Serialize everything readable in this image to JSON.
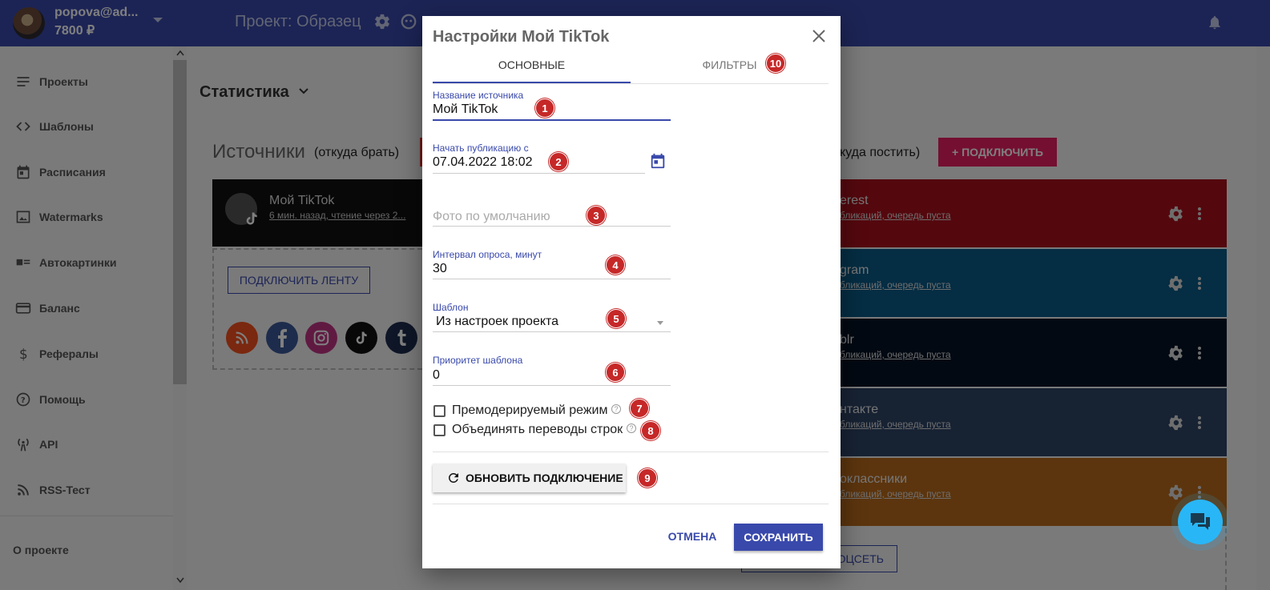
{
  "topbar": {
    "user_email": "popova@ad...",
    "user_balance": "7800 ₽",
    "project_title": "Проект: Образец"
  },
  "sidebar": {
    "items": [
      {
        "label": "Проекты",
        "icon": "list-icon"
      },
      {
        "label": "Шаблоны",
        "icon": "code-icon"
      },
      {
        "label": "Расписания",
        "icon": "calendar-icon"
      },
      {
        "label": "Watermarks",
        "icon": "image-icon"
      },
      {
        "label": "Автокартинки",
        "icon": "picture-list-icon"
      },
      {
        "label": "Баланс",
        "icon": "credit-card-icon"
      },
      {
        "label": "Рефералы",
        "icon": "dollar-icon"
      },
      {
        "label": "Помощь",
        "icon": "help-icon"
      },
      {
        "label": "API",
        "icon": "broadcast-icon"
      },
      {
        "label": "RSS-Тест",
        "icon": "rss-icon"
      }
    ],
    "about": "О проекте"
  },
  "main": {
    "stat_heading": "Статистика",
    "sources_title": "Источники",
    "sources_sub": "(откуда брать)",
    "source_card": {
      "name": "Мой TikTok",
      "info": "6 мин. назад, чтение через 2..."
    },
    "connect_feed": "ПОДКЛЮЧИТЬ ЛЕНТУ",
    "targets_sub": "куда постить)",
    "connect_button": "+ ПОДКЛЮЧИТЬ",
    "targets": [
      {
        "name": "erest",
        "info": "бликаций, очередь пуста",
        "color": "#a8101c"
      },
      {
        "name": "gram",
        "info": "бликаций, очередь пуста",
        "color": "#0a5a86"
      },
      {
        "name": "blr",
        "info": "бликаций, очередь пуста",
        "color": "#071325"
      },
      {
        "name": "нтакте",
        "info": "бликаций, очередь пуста",
        "color": "#2e4467"
      },
      {
        "name": "оклассники",
        "info": "бликаций, очередь пуста",
        "color": "#b86a1c"
      }
    ],
    "socnet_button": "ОЦСЕТЬ"
  },
  "dialog": {
    "title": "Настройки Мой TikTok",
    "tabs": [
      {
        "label": "ОСНОВНЫЕ"
      },
      {
        "label": "ФИЛЬТРЫ"
      }
    ],
    "fields": {
      "source_name": {
        "label": "Название источника",
        "value": "Мой TikTok"
      },
      "start_publication": {
        "label": "Начать публикацию с",
        "value": "07.04.2022 18:02"
      },
      "default_photo": {
        "placeholder": "Фото по умолчанию"
      },
      "poll_interval": {
        "label": "Интервал опроса, минут",
        "value": "30"
      },
      "template": {
        "label": "Шаблон",
        "value": "Из настроек проекта"
      },
      "template_priority": {
        "label": "Приоритет шаблона",
        "value": "0"
      }
    },
    "checkboxes": [
      {
        "label": "Премодерируемый режим",
        "checked": false
      },
      {
        "label": "Объединять переводы строк",
        "checked": false
      }
    ],
    "refresh_button": "ОБНОВИТЬ ПОДКЛЮЧЕНИЕ",
    "cancel_button": "ОТМЕНА",
    "save_button": "СОХРАНИТЬ",
    "badges": [
      "1",
      "2",
      "3",
      "4",
      "5",
      "6",
      "7",
      "8",
      "9",
      "10"
    ]
  },
  "colors": {
    "accent": "#3949ab",
    "pink": "#e91e63",
    "badge": "#c62828"
  }
}
